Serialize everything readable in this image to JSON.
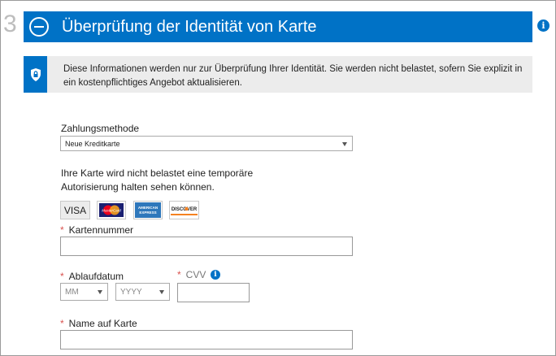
{
  "step": {
    "number": "3",
    "title": "Überprüfung der Identität von Karte"
  },
  "notice": {
    "text": "Diese Informationen werden nur zur Überprüfung Ihrer Identität. Sie werden nicht belastet, sofern Sie explizit in ein kostenpflichtiges Angebot aktualisieren."
  },
  "payment": {
    "method_label": "Zahlungsmethode",
    "method_value": "Neue Kreditkarte",
    "info_line1": "Ihre Karte wird nicht belastet eine temporäre",
    "info_line2": "Autorisierung halten sehen können.",
    "cards": {
      "visa": "VISA",
      "mastercard": "MasterCard",
      "amex": "AMERICAN EXPRESS",
      "discover": "DISCOVER"
    },
    "card_number_label": "Kartennummer",
    "expiry_label": "Ablaufdatum",
    "month_placeholder": "MM",
    "year_placeholder": "YYYY",
    "cvv_label": "CVV",
    "name_label": "Name auf Karte",
    "required_mark": "*"
  },
  "colors": {
    "accent": "#0072c6",
    "required": "#d9534f",
    "notice_bg": "#ececec"
  },
  "icons": {
    "collapse": "minus-circle-icon",
    "info": "info-icon",
    "shield": "shield-lock-icon"
  }
}
